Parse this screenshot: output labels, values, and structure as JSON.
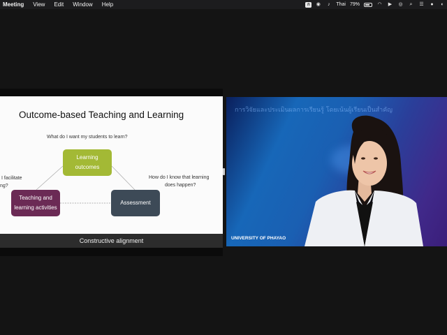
{
  "menubar": {
    "items": [
      "Meeting",
      "View",
      "Edit",
      "Window",
      "Help"
    ],
    "status": {
      "input_source": "Thai",
      "battery_percent": "79%",
      "battery_level": 0.79,
      "icons": [
        "screen-record-icon",
        "line-app-icon",
        "screen-share-icon",
        "notification-icon",
        "input-source-icon",
        "battery-icon",
        "wifi-icon",
        "play-icon",
        "user-icon",
        "search-icon",
        "control-center-icon",
        "siri-icon",
        "notes-icon"
      ]
    }
  },
  "slide": {
    "title": "Outcome-based Teaching and Learning",
    "question_top": "What do I want my students to learn?",
    "question_left_1": "I facilitate",
    "question_left_2": "ng?",
    "question_right_1": "How do I know that learning",
    "question_right_2": "does happen?",
    "boxes": {
      "outcomes": {
        "line1": "Learning",
        "line2": "outcomes",
        "color": "#a3b935"
      },
      "teaching": {
        "line1": "Teaching and",
        "line2": "learning activities",
        "color": "#6b2a55"
      },
      "assessment": {
        "label": "Assessment",
        "color": "#3d4a57"
      }
    },
    "caption": "Constructive alignment"
  },
  "video": {
    "banner": "การวิจัยและประเมินผลการเรียนรู้ โดยเน้นผู้เรียนเป็นสำคัญ",
    "participant_name": "UNIVERSITY OF PHAYAO"
  },
  "colors": {
    "background": "#141414",
    "menubar": "#1c1c1e",
    "caption_bar": "#2c2c2c"
  }
}
